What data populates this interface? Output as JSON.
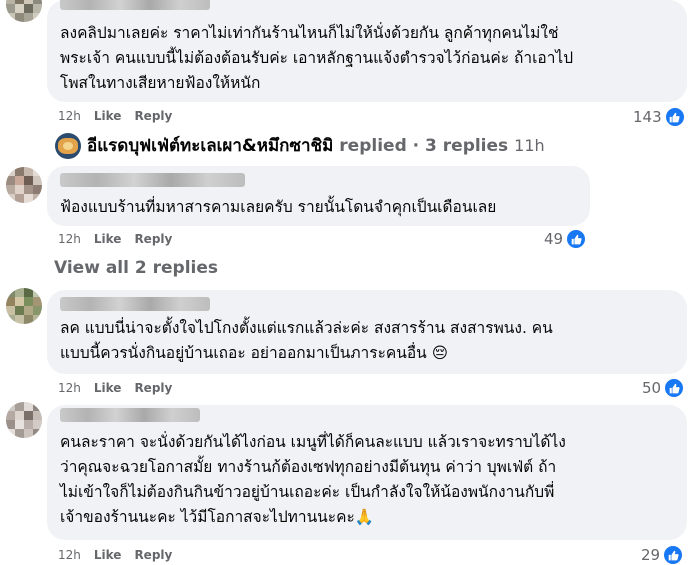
{
  "comments": [
    {
      "text": "ลงคลิปมาเลยค่ะ ราคาไม่เท่ากันร้านไหนก็ไม่ให้นั่งด้วยกัน ลูกค้าทุกคนไม่ใช่\nพระเจ้า คนแบบนี้ไม่ต้องต้อนรับค่ะ เอาหลักฐานแจ้งตำรวจไว้ก่อนค่ะ ถ้าเอาไป\nโพสในทางเสียหายฟ้องให้หนัก",
      "time": "12h",
      "like": "Like",
      "reply": "Reply",
      "reactions": "143"
    },
    {
      "text": "ฟ้องแบบร้านที่มหาสารคามเลยครับ รายนั้นโดนจำคุกเป็นเดือนเลย",
      "time": "12h",
      "like": "Like",
      "reply": "Reply",
      "reactions": "49"
    },
    {
      "text": "ลค แบบนี่น่าจะตั้งใจไปโกงตั้งแต่แรกแล้วล่ะค่ะ สงสารร้าน สงสารพนง. คน\nแบบนี้ควรนั่งกินอยู่บ้านเถอะ อย่าออกมาเป็นภาระคนอื่น 😔",
      "time": "12h",
      "like": "Like",
      "reply": "Reply",
      "reactions": "50"
    },
    {
      "text": "คนละราคา จะนั่งด้วยกันได้ไงก่อน เมนูที่ได้ก็คนละแบบ แล้วเราจะทราบได้ไง\nว่าคุณจะฉวยโอกาสมั้ย ทางร้านก้ต้องเซฟทุกอย่างมีต้นทุน ค่าว่า บุพเฟ่ต์ ถ้า\nไม่เข้าใจก็ไม่ต้องกินกินข้าวอยู่บ้านเถอะค่ะ เป็นกำลังใจให้น้องพนักงานกับพี่\nเจ้าของร้านนะคะ ไว้มีโอกาสจะไปทานนะคะ🙏",
      "time": "12h",
      "like": "Like",
      "reply": "Reply",
      "reactions": "29"
    }
  ],
  "replied": {
    "page_name": "อีแรดบุฟเฟ่ต์ทะเลเผา&หมึกซาชิมิ",
    "rest": "replied · 3 replies",
    "time": "11h"
  },
  "view_all": "View all 2 replies",
  "colors": {
    "bubble": "#f0f2f5",
    "meta": "#65676b",
    "like_blue": "#1877f2"
  }
}
